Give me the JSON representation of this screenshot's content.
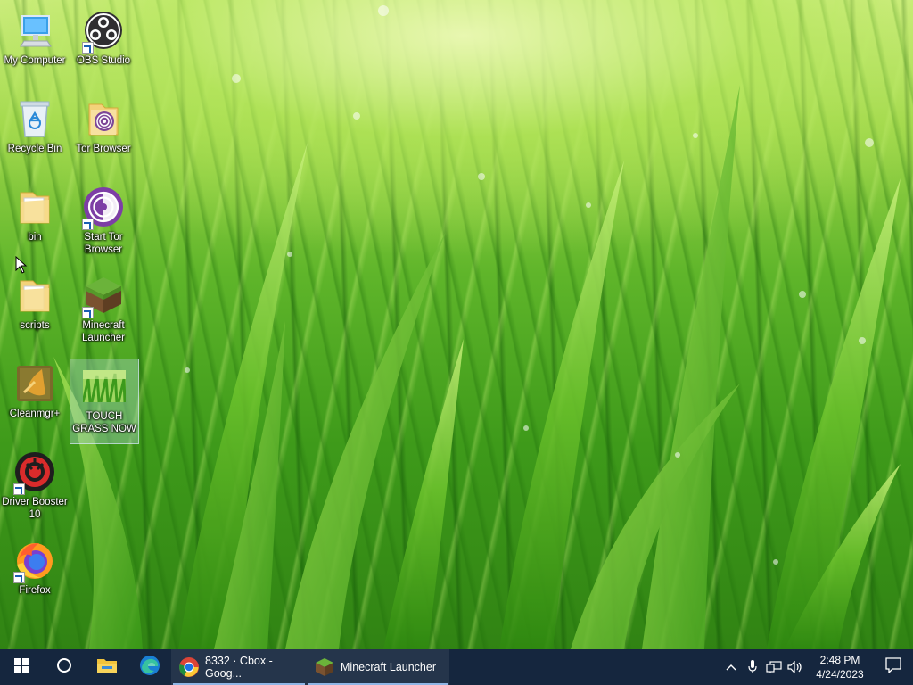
{
  "desktop": {
    "icons": [
      {
        "label": "My Computer",
        "icon": "computer-icon"
      },
      {
        "label": "OBS Studio",
        "icon": "obs-icon"
      },
      {
        "label": "Recycle Bin",
        "icon": "recycle-bin-icon"
      },
      {
        "label": "Tor Browser",
        "icon": "tor-folder-icon"
      },
      {
        "label": "bin",
        "icon": "folder-icon"
      },
      {
        "label": "Start Tor Browser",
        "icon": "tor-icon"
      },
      {
        "label": "scripts",
        "icon": "folder-icon"
      },
      {
        "label": "Minecraft Launcher",
        "icon": "minecraft-icon"
      },
      {
        "label": "Cleanmgr+",
        "icon": "cleanmgr-icon"
      },
      {
        "label": "TOUCH GRASS NOW",
        "icon": "grass-image-icon"
      },
      {
        "label": "Driver Booster 10",
        "icon": "driver-booster-icon"
      },
      {
        "label": "Firefox",
        "icon": "firefox-icon"
      }
    ]
  },
  "taskbar": {
    "start": "windows-start-icon",
    "search": "cortana-circle-icon",
    "pinned": [
      "file-explorer-icon",
      "edge-icon"
    ],
    "apps": [
      {
        "label": "8332 · Cbox - Goog...",
        "icon": "chrome-icon"
      },
      {
        "label": "Minecraft Launcher",
        "icon": "minecraft-icon"
      }
    ],
    "tray": {
      "icons": [
        "chevron-up-icon",
        "microphone-icon",
        "network-icon",
        "volume-icon"
      ],
      "time": "2:48 PM",
      "date": "4/24/2023",
      "notification": "action-center-icon"
    }
  },
  "colors": {
    "taskbar": "#15263e",
    "active_underline": "#8fb6e6"
  }
}
